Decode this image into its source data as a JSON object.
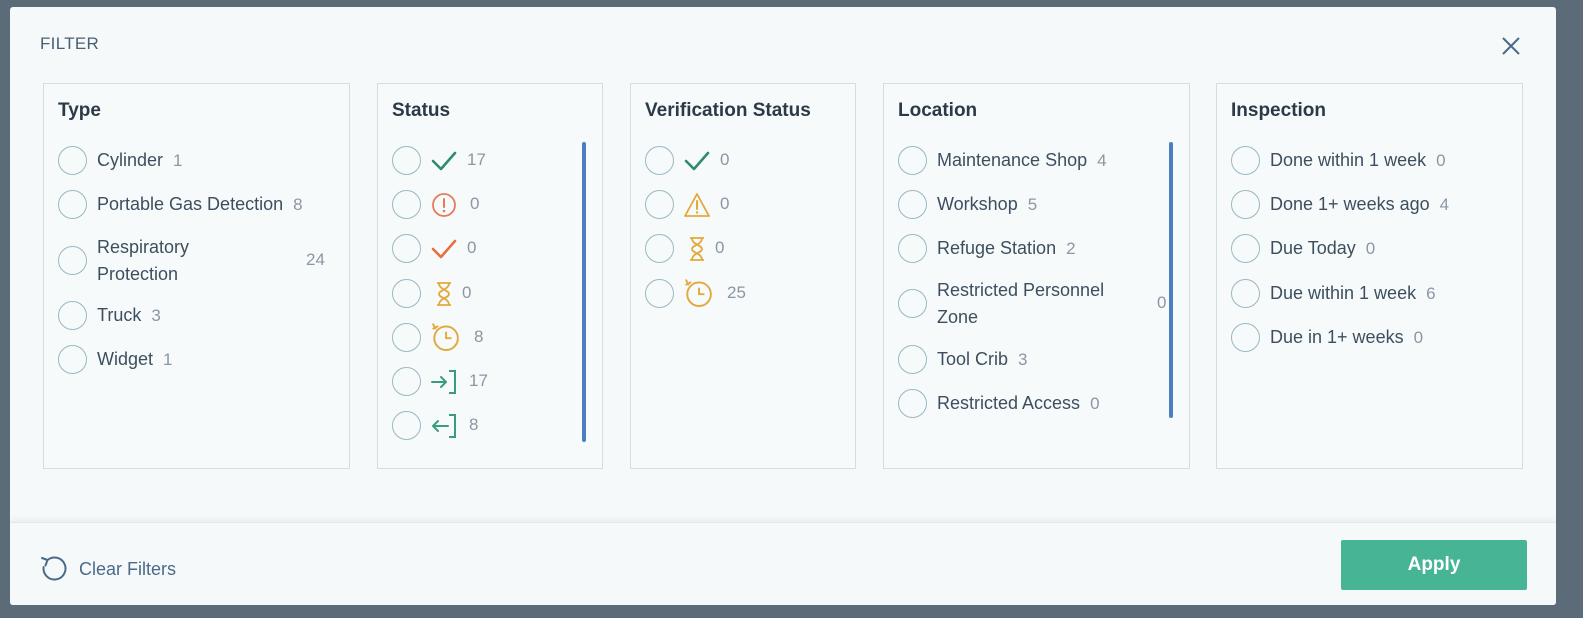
{
  "modal": {
    "title": "FILTER"
  },
  "panels": {
    "type": {
      "title": "Type",
      "options": [
        {
          "label": "Cylinder",
          "count": "1"
        },
        {
          "label": "Portable Gas Detection",
          "count": "8"
        },
        {
          "label": "Respiratory Protection",
          "count": "24"
        },
        {
          "label": "Truck",
          "count": "3"
        },
        {
          "label": "Widget",
          "count": "1"
        }
      ]
    },
    "status": {
      "title": "Status",
      "options": [
        {
          "icon": "check-icon",
          "count": "17",
          "color": "#2e8b6e"
        },
        {
          "icon": "alert-circle-icon",
          "count": "0",
          "color": "#e8795a"
        },
        {
          "icon": "check-icon",
          "count": "0",
          "color": "#e8703f"
        },
        {
          "icon": "hourglass-icon",
          "count": "0",
          "color": "#e2a93a"
        },
        {
          "icon": "overdue-timer-icon",
          "count": "8",
          "color": "#e2a93a"
        },
        {
          "icon": "check-in-icon",
          "count": "17",
          "color": "#3b9c7c"
        },
        {
          "icon": "check-out-icon",
          "count": "8",
          "color": "#3b9c7c"
        }
      ]
    },
    "verification": {
      "title": "Verification Status",
      "options": [
        {
          "icon": "check-icon",
          "count": "0",
          "color": "#2e8b6e"
        },
        {
          "icon": "warning-triangle-icon",
          "count": "0",
          "color": "#e2a93a"
        },
        {
          "icon": "hourglass-icon",
          "count": "0",
          "color": "#e2a93a"
        },
        {
          "icon": "overdue-timer-icon",
          "count": "25",
          "color": "#e2a93a"
        }
      ]
    },
    "location": {
      "title": "Location",
      "options": [
        {
          "label": "Maintenance Shop",
          "count": "4"
        },
        {
          "label": "Workshop",
          "count": "5"
        },
        {
          "label": "Refuge Station",
          "count": "2"
        },
        {
          "label": "Restricted Personnel Zone",
          "count": "0"
        },
        {
          "label": "Tool Crib",
          "count": "3"
        },
        {
          "label": "Restricted Access",
          "count": "0"
        }
      ]
    },
    "inspection": {
      "title": "Inspection",
      "options": [
        {
          "label": "Done within 1 week",
          "count": "0"
        },
        {
          "label": "Done 1+ weeks ago",
          "count": "4"
        },
        {
          "label": "Due Today",
          "count": "0"
        },
        {
          "label": "Due within 1 week",
          "count": "6"
        },
        {
          "label": "Due in 1+ weeks",
          "count": "0"
        }
      ]
    }
  },
  "footer": {
    "clear_label": "Clear Filters",
    "apply_label": "Apply",
    "apply_color": "#47b595"
  }
}
